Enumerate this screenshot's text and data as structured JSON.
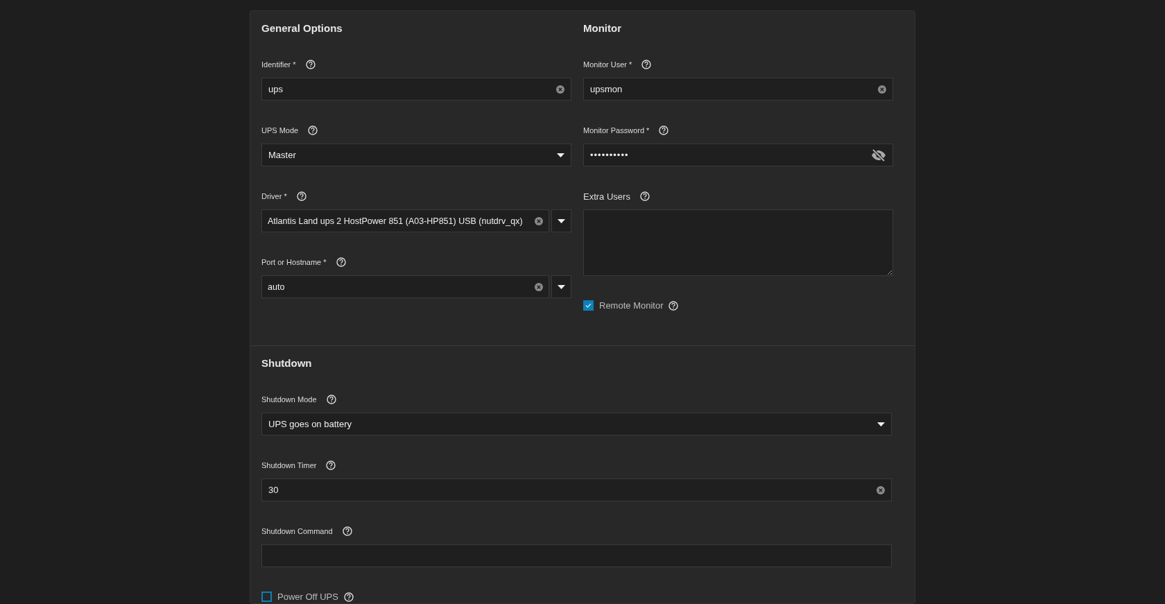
{
  "general_options": {
    "title": "General Options",
    "fields": [
      {
        "kind": "text",
        "label": "Identifier *",
        "value": "ups"
      },
      {
        "kind": "select",
        "label": "UPS Mode",
        "value": "Master"
      },
      {
        "kind": "combo",
        "label": "Driver *",
        "value": "Atlantis Land ups 2 HostPower 851 (A03-HP851) USB (nutdrv_qx)"
      },
      {
        "kind": "combo",
        "label": "Port or Hostname *",
        "value": "auto"
      }
    ]
  },
  "monitor": {
    "title": "Monitor",
    "fields": [
      {
        "kind": "text",
        "label": "Monitor User *",
        "value": "upsmon"
      },
      {
        "kind": "password",
        "label": "Monitor Password *",
        "value": "••••••••••"
      },
      {
        "kind": "textarea",
        "label": "Extra Users"
      },
      {
        "kind": "checkbox",
        "label": "Remote Monitor",
        "checked": true
      }
    ]
  },
  "shutdown": {
    "title": "Shutdown",
    "fields": [
      {
        "kind": "select",
        "label": "Shutdown Mode",
        "value": "UPS goes on battery"
      },
      {
        "kind": "text",
        "label": "Shutdown Timer",
        "value": "30"
      },
      {
        "kind": "text",
        "label": "Shutdown Command"
      },
      {
        "kind": "checkbox",
        "label": "Power Off UPS",
        "checked": false
      }
    ]
  }
}
